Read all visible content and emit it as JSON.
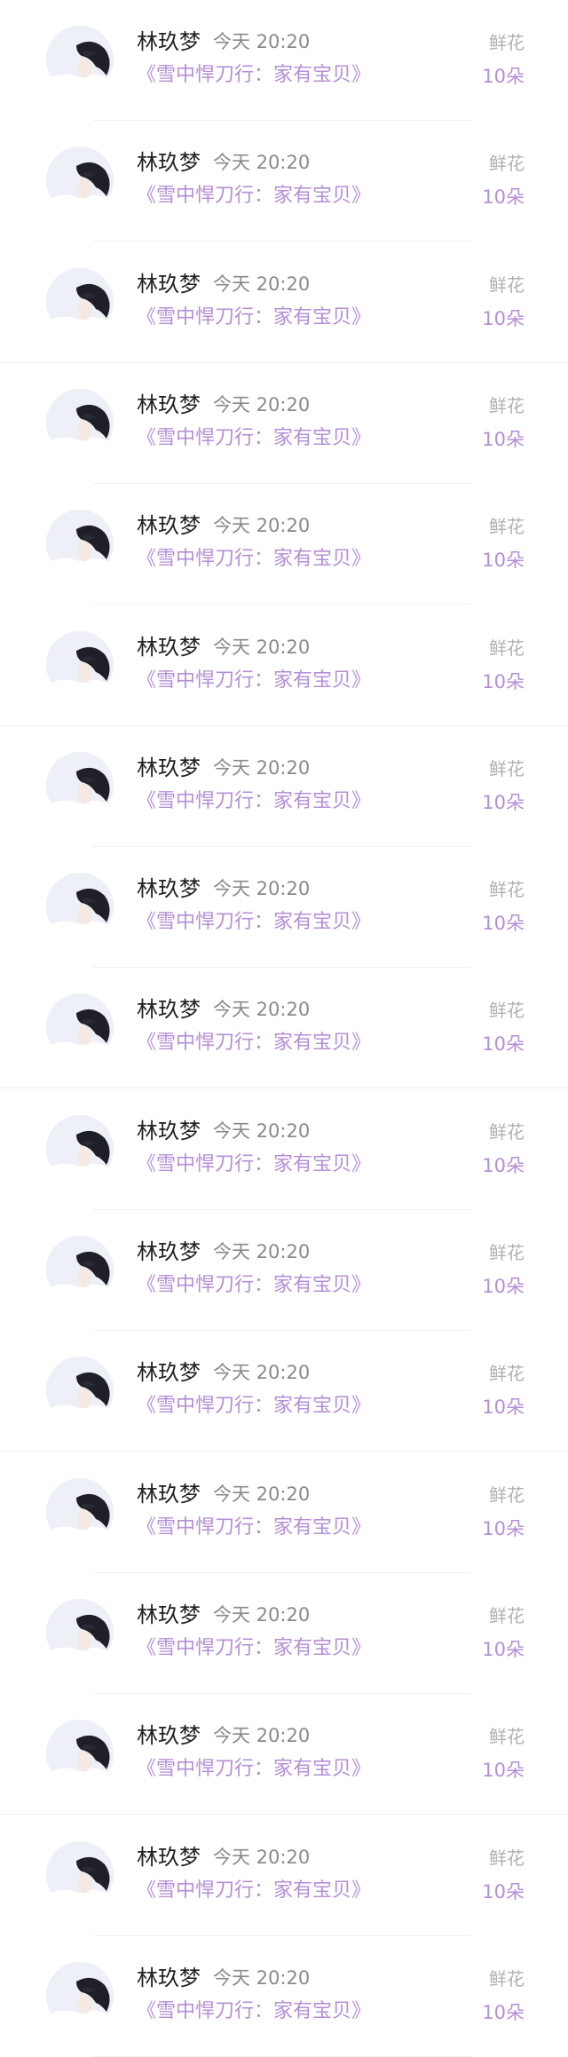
{
  "icons": {
    "avatar": "user-avatar-photo"
  },
  "colors": {
    "name": "#222222",
    "time": "#8a8a8a",
    "title_accent": "#b58fd6",
    "gift_label": "#b0b0b0",
    "divider": "#f0f0f0"
  },
  "rows": [
    {
      "name": "林玖梦",
      "time": "今天 20:20",
      "title": "《雪中悍刀行：家有宝贝》",
      "gift": "鲜花",
      "count": "10朵"
    },
    {
      "name": "林玖梦",
      "time": "今天 20:20",
      "title": "《雪中悍刀行：家有宝贝》",
      "gift": "鲜花",
      "count": "10朵"
    },
    {
      "name": "林玖梦",
      "time": "今天 20:20",
      "title": "《雪中悍刀行：家有宝贝》",
      "gift": "鲜花",
      "count": "10朵"
    },
    {
      "name": "林玖梦",
      "time": "今天 20:20",
      "title": "《雪中悍刀行：家有宝贝》",
      "gift": "鲜花",
      "count": "10朵"
    },
    {
      "name": "林玖梦",
      "time": "今天 20:20",
      "title": "《雪中悍刀行：家有宝贝》",
      "gift": "鲜花",
      "count": "10朵"
    },
    {
      "name": "林玖梦",
      "time": "今天 20:20",
      "title": "《雪中悍刀行：家有宝贝》",
      "gift": "鲜花",
      "count": "10朵"
    },
    {
      "name": "林玖梦",
      "time": "今天 20:20",
      "title": "《雪中悍刀行：家有宝贝》",
      "gift": "鲜花",
      "count": "10朵"
    },
    {
      "name": "林玖梦",
      "time": "今天 20:20",
      "title": "《雪中悍刀行：家有宝贝》",
      "gift": "鲜花",
      "count": "10朵"
    },
    {
      "name": "林玖梦",
      "time": "今天 20:20",
      "title": "《雪中悍刀行：家有宝贝》",
      "gift": "鲜花",
      "count": "10朵"
    },
    {
      "name": "林玖梦",
      "time": "今天 20:20",
      "title": "《雪中悍刀行：家有宝贝》",
      "gift": "鲜花",
      "count": "10朵"
    },
    {
      "name": "林玖梦",
      "time": "今天 20:20",
      "title": "《雪中悍刀行：家有宝贝》",
      "gift": "鲜花",
      "count": "10朵"
    },
    {
      "name": "林玖梦",
      "time": "今天 20:20",
      "title": "《雪中悍刀行：家有宝贝》",
      "gift": "鲜花",
      "count": "10朵"
    },
    {
      "name": "林玖梦",
      "time": "今天 20:20",
      "title": "《雪中悍刀行：家有宝贝》",
      "gift": "鲜花",
      "count": "10朵"
    },
    {
      "name": "林玖梦",
      "time": "今天 20:20",
      "title": "《雪中悍刀行：家有宝贝》",
      "gift": "鲜花",
      "count": "10朵"
    },
    {
      "name": "林玖梦",
      "time": "今天 20:20",
      "title": "《雪中悍刀行：家有宝贝》",
      "gift": "鲜花",
      "count": "10朵"
    },
    {
      "name": "林玖梦",
      "time": "今天 20:20",
      "title": "《雪中悍刀行：家有宝贝》",
      "gift": "鲜花",
      "count": "10朵"
    },
    {
      "name": "林玖梦",
      "time": "今天 20:20",
      "title": "《雪中悍刀行：家有宝贝》",
      "gift": "鲜花",
      "count": "10朵"
    }
  ]
}
